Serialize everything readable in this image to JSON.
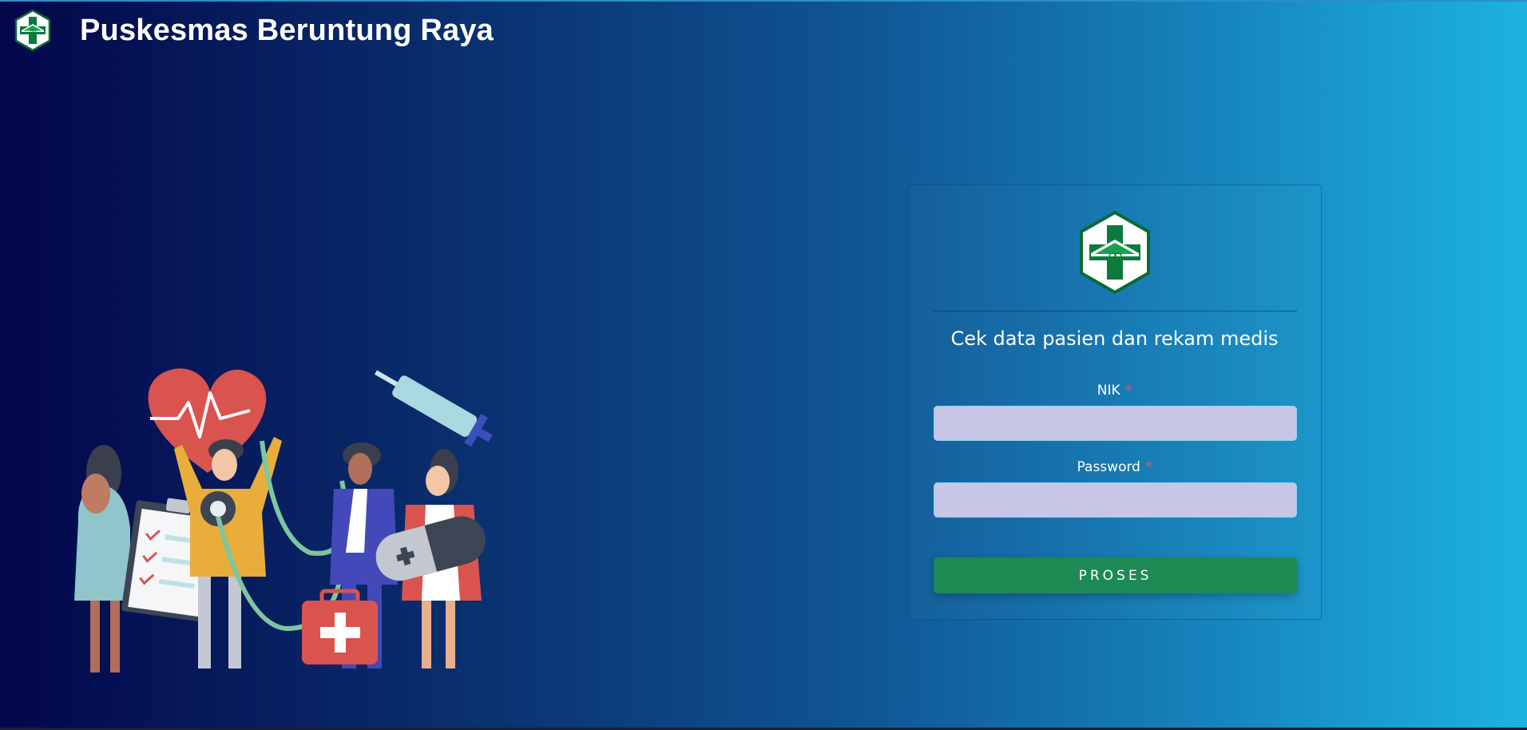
{
  "header": {
    "logo_icon": "puskesmas-logo-icon",
    "title": "Puskesmas Beruntung Raya"
  },
  "illustration": {
    "icon": "medical-team-illustration"
  },
  "login_card": {
    "logo_icon": "puskesmas-logo-icon",
    "heading": "Cek data pasien dan rekam medis",
    "nik": {
      "label": "NIK",
      "required_mark": "*",
      "value": "",
      "placeholder": ""
    },
    "password": {
      "label": "Password",
      "required_mark": "*",
      "value": "",
      "placeholder": ""
    },
    "submit_label": "PROSES"
  },
  "colors": {
    "gradient_start": "#03064a",
    "gradient_end": "#1cb3e0",
    "input_bg": "#c8c6e6",
    "button_bg": "#1d8a54",
    "required": "#e5546b",
    "logo_green": "#0b7a3b"
  }
}
